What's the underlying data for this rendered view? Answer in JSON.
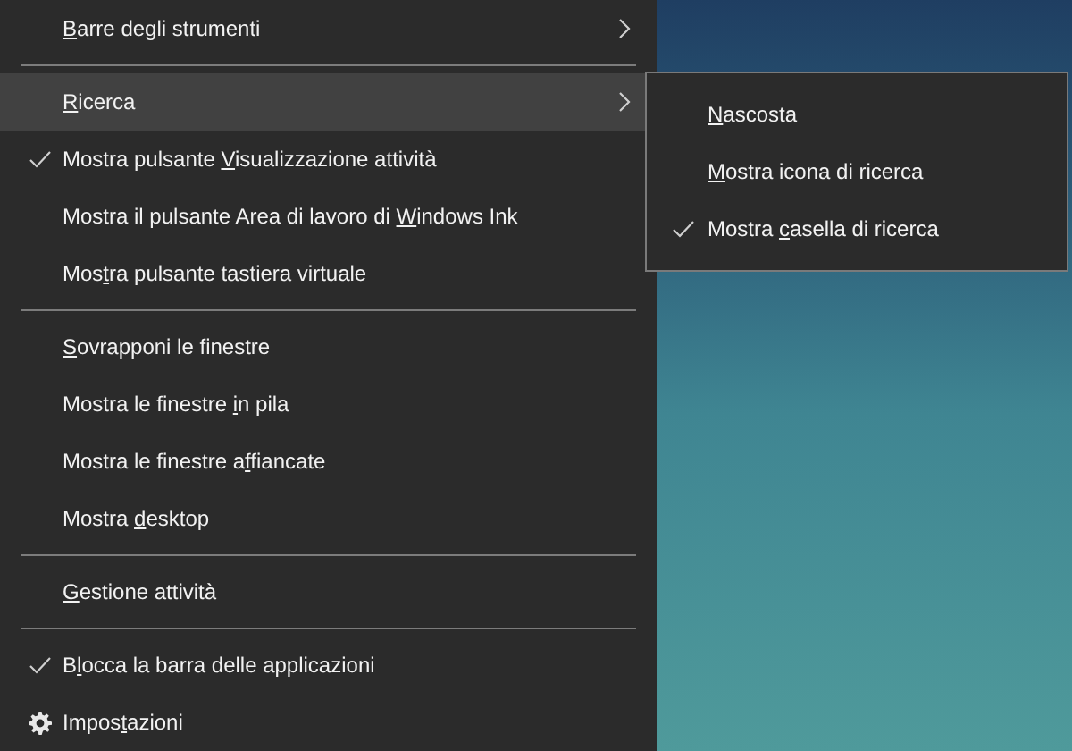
{
  "menu": {
    "items": [
      {
        "kind": "item",
        "label": {
          "key": "B",
          "post": "arre degli strumenti"
        },
        "checked": false,
        "submenu": true,
        "selected": false
      },
      {
        "kind": "separator"
      },
      {
        "kind": "item",
        "label": {
          "key": "R",
          "post": "icerca"
        },
        "checked": false,
        "submenu": true,
        "selected": true
      },
      {
        "kind": "item",
        "label": {
          "pre": "Mostra pulsante ",
          "key": "V",
          "post": "isualizzazione attività"
        },
        "checked": true,
        "submenu": false,
        "selected": false
      },
      {
        "kind": "item",
        "label": {
          "pre": "Mostra il pulsante Area di lavoro di ",
          "key": "W",
          "post": "indows Ink"
        },
        "checked": false,
        "submenu": false,
        "selected": false
      },
      {
        "kind": "item",
        "label": {
          "pre": "Mos",
          "key": "t",
          "post": "ra pulsante tastiera virtuale"
        },
        "checked": false,
        "submenu": false,
        "selected": false
      },
      {
        "kind": "separator"
      },
      {
        "kind": "item",
        "label": {
          "key": "S",
          "post": "ovrapponi le finestre"
        },
        "checked": false,
        "submenu": false,
        "selected": false
      },
      {
        "kind": "item",
        "label": {
          "pre": "Mostra le finestre ",
          "key": "i",
          "post": "n pila"
        },
        "checked": false,
        "submenu": false,
        "selected": false
      },
      {
        "kind": "item",
        "label": {
          "pre": "Mostra le finestre a",
          "key": "f",
          "post": "fiancate"
        },
        "checked": false,
        "submenu": false,
        "selected": false
      },
      {
        "kind": "item",
        "label": {
          "pre": "Mostra ",
          "key": "d",
          "post": "esktop"
        },
        "checked": false,
        "submenu": false,
        "selected": false
      },
      {
        "kind": "separator"
      },
      {
        "kind": "item",
        "label": {
          "key": "G",
          "post": "estione attività"
        },
        "checked": false,
        "submenu": false,
        "selected": false
      },
      {
        "kind": "separator"
      },
      {
        "kind": "item",
        "label": {
          "pre": "B",
          "key": "l",
          "post": "occa la barra delle applicazioni"
        },
        "checked": true,
        "submenu": false,
        "selected": false
      },
      {
        "kind": "settings",
        "label": {
          "pre": "Impos",
          "key": "t",
          "post": "azioni"
        },
        "submenu": false,
        "selected": false
      }
    ]
  },
  "submenu": {
    "items": [
      {
        "kind": "item",
        "label": {
          "key": "N",
          "post": "ascosta"
        },
        "checked": false
      },
      {
        "kind": "item",
        "label": {
          "key": "M",
          "post": "ostra icona di ricerca"
        },
        "checked": false
      },
      {
        "kind": "item",
        "label": {
          "pre": "Mostra ",
          "key": "c",
          "post": "asella di ricerca"
        },
        "checked": true
      }
    ]
  }
}
